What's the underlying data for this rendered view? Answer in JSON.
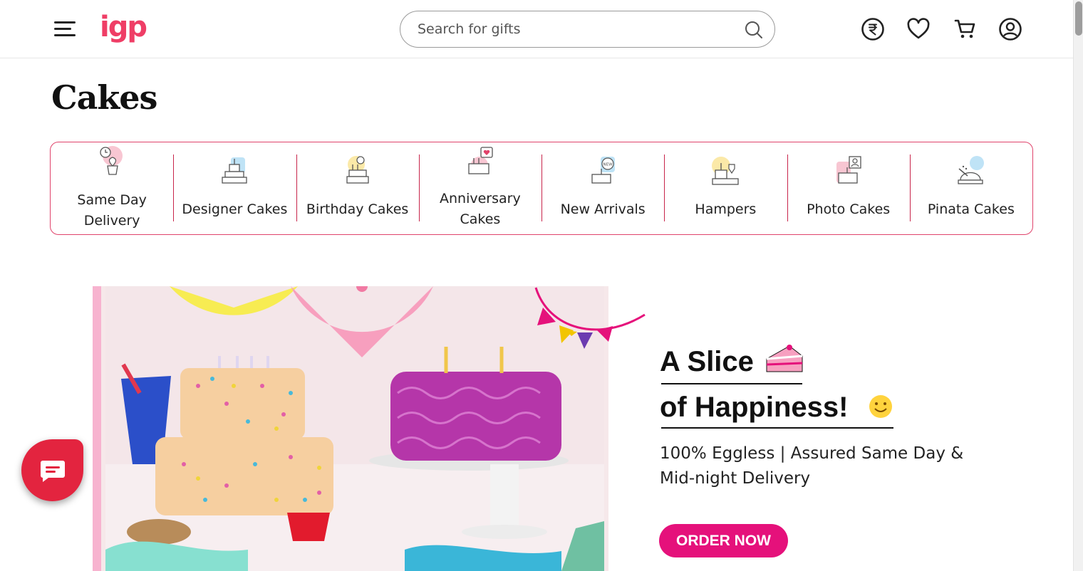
{
  "header": {
    "logo": "igp",
    "search_placeholder": "Search for gifts",
    "icons": [
      "menu-icon",
      "search-icon",
      "rupee-icon",
      "heart-icon",
      "cart-icon",
      "account-icon"
    ]
  },
  "page": {
    "title": "Cakes"
  },
  "categories": [
    {
      "label_line1": "Same Day",
      "label_line2": "Delivery",
      "icon": "plant-clock-icon"
    },
    {
      "label_line1": "Designer Cakes",
      "label_line2": "",
      "icon": "tiered-cake-icon"
    },
    {
      "label_line1": "Birthday Cakes",
      "label_line2": "",
      "icon": "birthday-cake-balloon-icon"
    },
    {
      "label_line1": "Anniversary",
      "label_line2": "Cakes",
      "icon": "anniversary-cake-calendar-icon"
    },
    {
      "label_line1": "New Arrivals",
      "label_line2": "",
      "icon": "new-cake-icon"
    },
    {
      "label_line1": "Hampers",
      "label_line2": "",
      "icon": "hamper-icon"
    },
    {
      "label_line1": "Photo Cakes",
      "label_line2": "",
      "icon": "photo-cake-icon"
    },
    {
      "label_line1": "Pinata Cakes",
      "label_line2": "",
      "icon": "pinata-cake-icon"
    }
  ],
  "banner": {
    "headline_line1": "A Slice",
    "headline_line2": "of Happiness!",
    "subtext_line1": "100% Eggless | Assured Same Day &",
    "subtext_line2": "Mid-night Delivery",
    "cta": "ORDER NOW"
  },
  "colors": {
    "brand": "#ef3e66",
    "strip_border": "#e0436b",
    "cta": "#e5117b",
    "chat": "#e3243f"
  }
}
